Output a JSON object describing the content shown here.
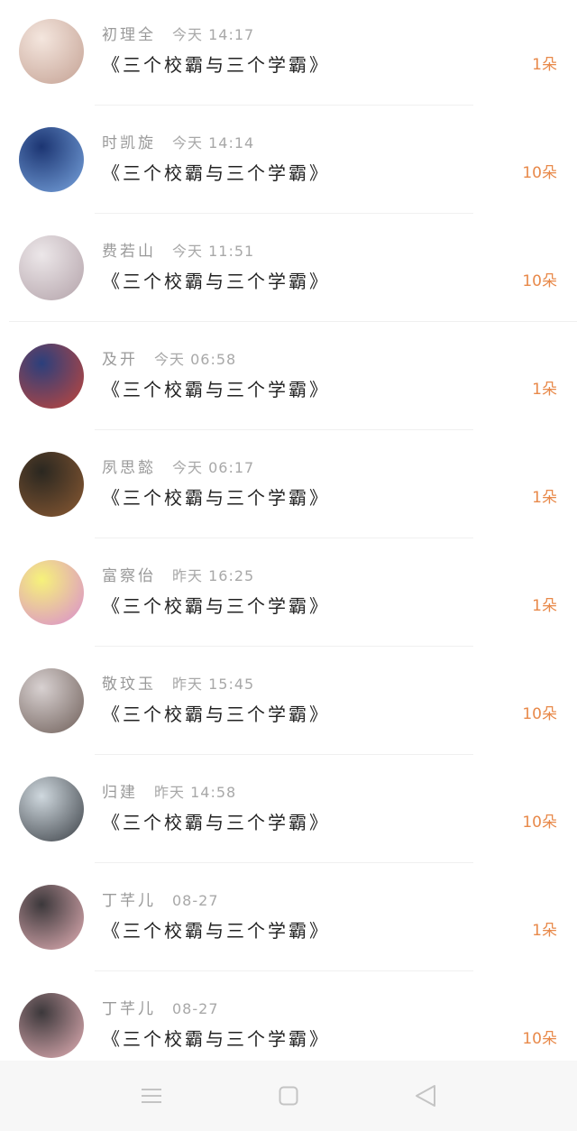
{
  "rows": [
    {
      "name": "初理全",
      "time": "今天 14:17",
      "title": "《三个校霸与三个学霸》",
      "count": "1朵",
      "avatar": {
        "from": "#f4e6de",
        "to": "#c4a193"
      }
    },
    {
      "name": "时凯旋",
      "time": "今天 14:14",
      "title": "《三个校霸与三个学霸》",
      "count": "10朵",
      "avatar": {
        "from": "#1c3572",
        "to": "#78a4de"
      }
    },
    {
      "name": "费若山",
      "time": "今天 11:51",
      "title": "《三个校霸与三个学霸》",
      "count": "10朵",
      "avatar": {
        "from": "#ece7e9",
        "to": "#b3a2a9"
      }
    },
    {
      "name": "及开",
      "time": "今天 06:58",
      "title": "《三个校霸与三个学霸》",
      "count": "1朵",
      "avatar": {
        "from": "#2b3f7c",
        "to": "#c4463b"
      }
    },
    {
      "name": "夙思懿",
      "time": "今天 06:17",
      "title": "《三个校霸与三个学霸》",
      "count": "1朵",
      "avatar": {
        "from": "#2a2720",
        "to": "#8b5a33"
      }
    },
    {
      "name": "富察佁",
      "time": "昨天 16:25",
      "title": "《三个校霸与三个学霸》",
      "count": "1朵",
      "avatar": {
        "from": "#f6f27a",
        "to": "#d98bd0"
      }
    },
    {
      "name": "敬玟玉",
      "time": "昨天 15:45",
      "title": "《三个校霸与三个学霸》",
      "count": "10朵",
      "avatar": {
        "from": "#d8d1d1",
        "to": "#6f5f59"
      }
    },
    {
      "name": "归建",
      "time": "昨天 14:58",
      "title": "《三个校霸与三个学霸》",
      "count": "10朵",
      "avatar": {
        "from": "#cfd8de",
        "to": "#3b4046"
      }
    },
    {
      "name": "丁芊儿",
      "time": "08-27",
      "title": "《三个校霸与三个学霸》",
      "count": "1朵",
      "avatar": {
        "from": "#3c383b",
        "to": "#e4b0b6"
      }
    },
    {
      "name": "丁芊儿",
      "time": "08-27",
      "title": "《三个校霸与三个学霸》",
      "count": "10朵",
      "avatar": {
        "from": "#3c383b",
        "to": "#e4b0b6"
      }
    }
  ],
  "navbar": {
    "buttons": [
      {
        "icon": "menu-icon"
      },
      {
        "icon": "home-square-icon"
      },
      {
        "icon": "back-triangle-icon"
      }
    ],
    "icon_color": "#c4c4c4",
    "background": "#f7f7f7"
  },
  "colors": {
    "count": "#e8894a",
    "name": "#9a9a9a",
    "title": "#222222"
  }
}
